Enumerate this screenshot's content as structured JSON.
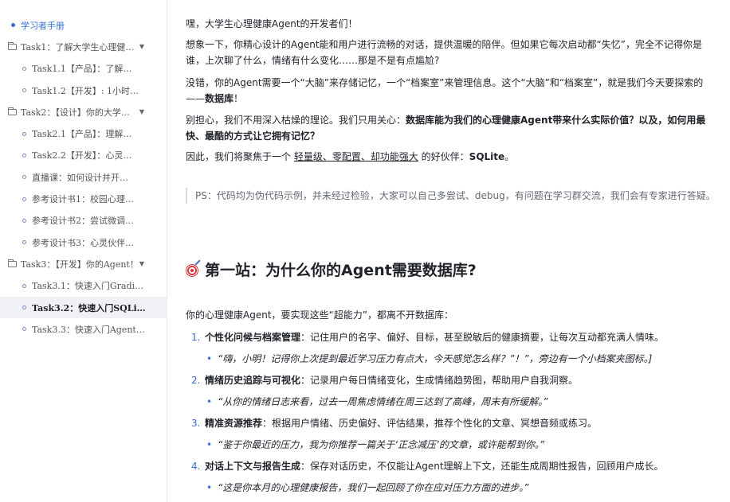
{
  "sidebar": {
    "items": [
      {
        "label": "学习者手册",
        "type": "root"
      },
      {
        "label": "Task1：了解大学生心理健…",
        "type": "group"
      },
      {
        "label": "Task1.1【产品】：了解…",
        "type": "child"
      },
      {
        "label": "Task1.2【开发】: 1小时…",
        "type": "child"
      },
      {
        "label": "Task2：【设计】你的大学…",
        "type": "group"
      },
      {
        "label": "Task2.1【产品】：理解…",
        "type": "child"
      },
      {
        "label": "Task2.2【开发】：心灵…",
        "type": "child"
      },
      {
        "label": "直播课：如何设计并开…",
        "type": "child"
      },
      {
        "label": "参考设计书1：校园心理…",
        "type": "child"
      },
      {
        "label": "参考设计书2：尝试微调…",
        "type": "child"
      },
      {
        "label": "参考设计书3：心灵伙伴…",
        "type": "child"
      },
      {
        "label": "Task3：【开发】你的Agent！",
        "type": "group"
      },
      {
        "label": "Task3.1：快速入门Gradi…",
        "type": "child"
      },
      {
        "label": "Task3.2：快速入门SQLi…",
        "type": "child",
        "active": true
      },
      {
        "label": "Task3.3：快速入门Agent…",
        "type": "child"
      }
    ]
  },
  "content": {
    "p1": "嘿，大学生心理健康Agent的开发者们！",
    "p2": "想象一下，你精心设计的Agent能和用户进行流畅的对话，提供温暖的陪伴。但如果它每次启动都“失忆”，完全不记得你是谁，上次聊了什么，情绪有什么变化……那是不是有点尴尬?",
    "p3a": "没错，你的Agent需要一个“大脑”来存储记忆，一个“档案室”来管理信息。这个“大脑”和“档案室”，就是我们今天要探索的——",
    "p3b": "数据库",
    "p3c": "！",
    "p4a": "别担心，我们不用深入枯燥的理论。我们只用关心：",
    "p4b": "数据库能为我们的心理健康Agent带来什么实际价值？以及，如何用最快、最酷的方式让它拥有记忆？",
    "p5a": "因此，我们将聚焦于一个 ",
    "p5b": "轻量级、零配置、却功能强大",
    "p5c": " 的好伙伴：",
    "p5d": "SQLite",
    "p5e": "。",
    "quote": "PS：代码均为伪代码示例，并未经过检验，大家可以自己多尝试、debug，有问题在学习群交流，我们会有专家进行答疑。",
    "heading": "第一站：为什么你的Agent需要数据库?",
    "intro": "你的心理健康Agent，要实现这些“超能力”，都离不开数据库：",
    "list": [
      {
        "num": "1.",
        "title": "个性化问候与档案管理",
        "text": "：记住用户的名字、偏好、目标，甚至脱敏后的健康摘要，让每次互动都充满人情味。",
        "sub": "“嗨，小明！记得你上次提到最近学习压力有点大，今天感觉怎么样？”！”，旁边有一个小档案夹图标。]"
      },
      {
        "num": "2.",
        "title": "情绪历史追踪与可视化",
        "text": "：记录用户每日情绪变化，生成情绪趋势图，帮助用户自我洞察。",
        "sub": "“从你的情绪日志来看，过去一周焦虑情绪在周三达到了高峰，周末有所缓解。”"
      },
      {
        "num": "3.",
        "title": "精准资源推荐",
        "text": "：根据用户情绪、历史偏好、评估结果，推荐个性化的文章、冥想音频或练习。",
        "sub": "“鉴于你最近的压力，我为你推荐一篇关于‘正念减压’的文章，或许能帮到你。”"
      },
      {
        "num": "4.",
        "title": "对话上下文与报告生成",
        "text": "：保存对话历史，不仅能让Agent理解上下文，还能生成周期性报告，回顾用户成长。",
        "sub": "“这是你本月的心理健康报告，我们一起回顾了你在应对压力方面的进步。”"
      }
    ]
  }
}
